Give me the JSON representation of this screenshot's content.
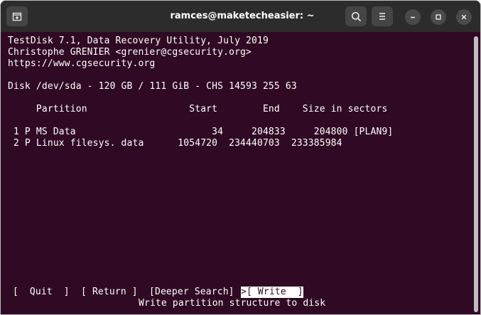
{
  "window": {
    "title": "ramces@maketecheasier: ~"
  },
  "icons": {
    "new_tab": "new-tab-icon",
    "search": "search-icon",
    "menu": "hamburger-menu-icon",
    "minimize": "minimize-icon",
    "maximize": "maximize-icon",
    "close": "close-icon"
  },
  "colors": {
    "terminal_bg": "#300a24",
    "titlebar_bg": "#2c2c2c",
    "text": "#ffffff"
  },
  "terminal": {
    "header1": "TestDisk 7.1, Data Recovery Utility, July 2019",
    "header2": "Christophe GRENIER <grenier@cgsecurity.org>",
    "header3": "https://www.cgsecurity.org",
    "disk": "Disk /dev/sda - 120 GB / 111 GiB - CHS 14593 255 63",
    "columns": "     Partition                  Start        End    Size in sectors",
    "rows": [
      " 1 P MS Data                        34     204833     204800 [PLAN9]",
      " 2 P Linux filesys. data      1054720  234440703  233385984"
    ],
    "menu": {
      "quit": "[  Quit  ]",
      "return": "[ Return ]",
      "deeper_search": "[Deeper Search]",
      "write": ">[ Write  ]"
    },
    "hint": "Write partition structure to disk"
  }
}
